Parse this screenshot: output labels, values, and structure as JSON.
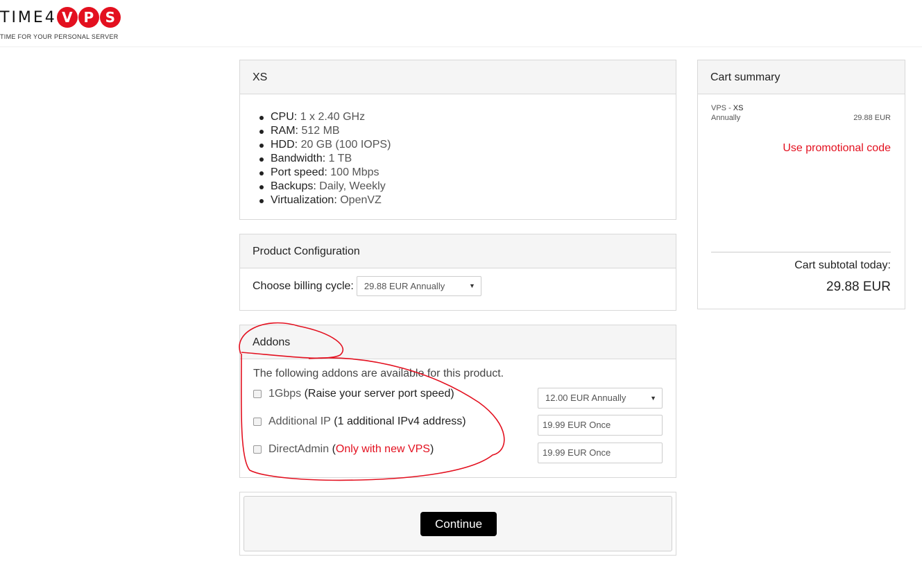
{
  "brand": {
    "logo_prefix": "TIME4",
    "logo_letters": [
      "V",
      "P",
      "S"
    ],
    "tagline": "TIME FOR YOUR PERSONAL SERVER",
    "accent_color": "#e3101f"
  },
  "product": {
    "title": "XS",
    "specs": [
      {
        "label": "CPU:",
        "value": "1 x 2.40 GHz"
      },
      {
        "label": "RAM:",
        "value": "512 MB"
      },
      {
        "label": "HDD:",
        "value": "20 GB (100 IOPS)"
      },
      {
        "label": "Bandwidth:",
        "value": "1 TB"
      },
      {
        "label": "Port speed:",
        "value": "100 Mbps"
      },
      {
        "label": "Backups:",
        "value": "Daily, Weekly"
      },
      {
        "label": "Virtualization:",
        "value": "OpenVZ"
      }
    ]
  },
  "config": {
    "title": "Product Configuration",
    "billing_label": "Choose billing cycle:",
    "billing_value": "29.88 EUR Annually"
  },
  "addons": {
    "title": "Addons",
    "intro": "The following addons are available for this product.",
    "items": [
      {
        "name": "1Gbps",
        "desc_open": " (",
        "desc": "Raise your server port speed",
        "desc_close": ")",
        "price": "12.00 EUR Annually",
        "control": "select",
        "checked": false
      },
      {
        "name": "Additional IP",
        "desc_open": " (",
        "desc": "1 additional IPv4 address",
        "desc_close": ")",
        "price": "19.99 EUR Once",
        "control": "text",
        "checked": false
      },
      {
        "name": "DirectAdmin",
        "desc_open": " (",
        "desc": "Only with new VPS",
        "desc_close": ")",
        "price": "19.99 EUR Once",
        "control": "text",
        "checked": false
      }
    ]
  },
  "actions": {
    "continue_label": "Continue"
  },
  "cart": {
    "title": "Cart summary",
    "item_prefix": "VPS - ",
    "item_name": "XS",
    "item_cycle": "Annually",
    "item_price": "29.88 EUR",
    "promo_label": "Use promotional code",
    "subtotal_label": "Cart subtotal today:",
    "subtotal_value": "29.88 EUR"
  },
  "icons": {
    "dropdown": "caret-down-icon",
    "checkbox": "checkbox-icon"
  }
}
